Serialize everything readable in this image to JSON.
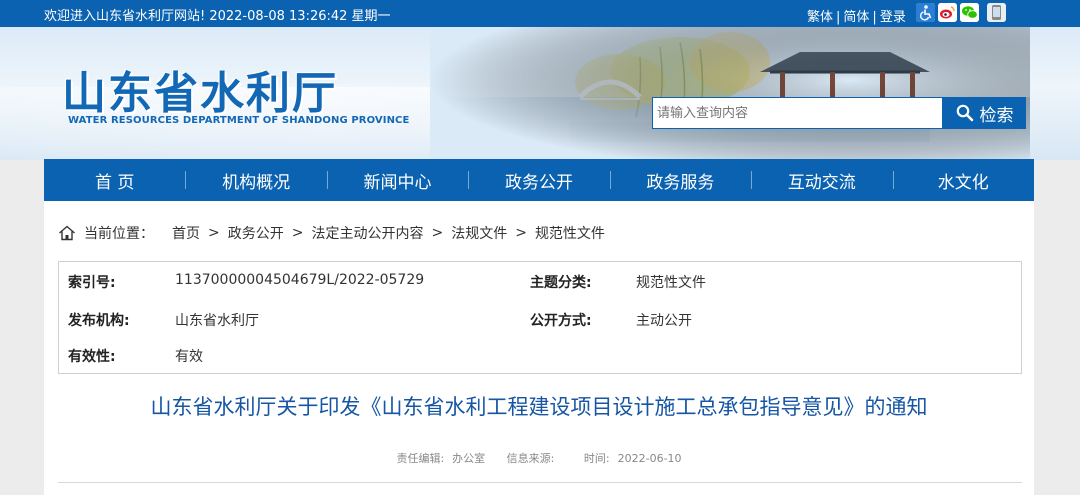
{
  "topbar": {
    "welcome": "欢迎进入山东省水利厅网站! 2022-08-08 13:26:42 星期一",
    "traditional": "繁体",
    "simplified": "简体",
    "login": "登录",
    "separator": "|",
    "icons": [
      "accessibility-icon",
      "weibo-icon",
      "wechat-icon",
      "mobile-icon"
    ]
  },
  "header": {
    "logo_cn": "山东省水利厅",
    "logo_en": "WATER RESOURCES DEPARTMENT OF SHANDONG PROVINCE",
    "search_placeholder": "请输入查询内容",
    "search_button": "检索"
  },
  "nav": {
    "items": [
      "首 页",
      "机构概况",
      "新闻中心",
      "政务公开",
      "政务服务",
      "互动交流",
      "水文化"
    ]
  },
  "breadcrumb": {
    "label": "当前位置：",
    "items": [
      "首页",
      "政务公开",
      "法定主动公开内容",
      "法规文件",
      "规范性文件"
    ],
    "arrow": ">"
  },
  "meta": {
    "index_key": "索引号:",
    "index_val": "11370000004504679L/2022-05729",
    "topic_key": "主题分类:",
    "topic_val": "规范性文件",
    "publisher_key": "发布机构:",
    "publisher_val": "山东省水利厅",
    "method_key": "公开方式:",
    "method_val": "主动公开",
    "validity_key": "有效性:",
    "validity_val": "有效"
  },
  "document": {
    "title": "山东省水利厅关于印发《山东省水利工程建设项目设计施工总承包指导意见》的通知",
    "editor_label": "责任编辑:",
    "editor": "办公室",
    "source_label": "信息来源:",
    "source": "",
    "time_label": "时间:",
    "time": "2022-06-10"
  },
  "colors": {
    "primary": "#0b62b0",
    "title_blue": "#1656a4",
    "logo_blue": "#1368b6"
  }
}
